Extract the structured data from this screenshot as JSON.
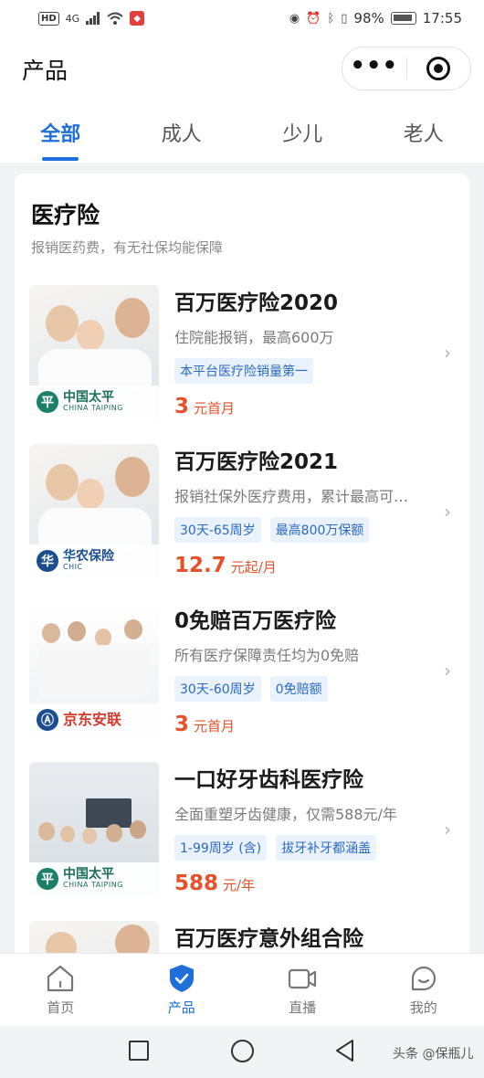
{
  "status": {
    "hd": "HD",
    "signal": "4G",
    "battery": "98%",
    "time": "17:55"
  },
  "header": {
    "title": "产品"
  },
  "tabs": [
    {
      "label": "全部"
    },
    {
      "label": "成人"
    },
    {
      "label": "少儿"
    },
    {
      "label": "老人"
    }
  ],
  "section": {
    "title": "医疗险",
    "subtitle": "报销医药费，有无社保均能保障"
  },
  "products": [
    {
      "name": "百万医疗险2020",
      "desc": "住院能报销，最高600万",
      "tags": [
        "本平台医疗险销量第一"
      ],
      "price": "3",
      "unit": "元首月",
      "logo": {
        "cn": "中国太平",
        "en": "CHINA TAIPING",
        "icon": "taiping-logo-icon"
      }
    },
    {
      "name": "百万医疗险2021",
      "desc": "报销社保外医疗费用，累计最高可…",
      "tags": [
        "30天-65周岁",
        "最高800万保额"
      ],
      "price": "12.7",
      "unit": "元起/月",
      "logo": {
        "cn": "华农保险",
        "en": "CHIC",
        "icon": "chic-logo-icon"
      }
    },
    {
      "name": "0免赔百万医疗险",
      "desc": "所有医疗保障责任均为0免赔",
      "tags": [
        "30天-60周岁",
        "0免赔额"
      ],
      "price": "3",
      "unit": "元首月",
      "logo": {
        "cn": "京东安联",
        "en": "",
        "icon": "jd-allianz-logo-icon"
      }
    },
    {
      "name": "一口好牙齿科医疗险",
      "desc": "全面重塑牙齿健康，仅需588元/年",
      "tags": [
        "1-99周岁 (含)",
        "拔牙补牙都涵盖"
      ],
      "price": "588",
      "unit": "元/年",
      "logo": {
        "cn": "中国太平",
        "en": "CHINA TAIPING",
        "icon": "taiping-logo-icon"
      }
    },
    {
      "name": "百万医疗意外组合险"
    }
  ],
  "nav": [
    {
      "label": "首页",
      "icon": "home-icon"
    },
    {
      "label": "产品",
      "icon": "shield-check-icon"
    },
    {
      "label": "直播",
      "icon": "video-camera-icon"
    },
    {
      "label": "我的",
      "icon": "smile-face-icon"
    }
  ],
  "watermark": "头条 @保瓶儿",
  "colors": {
    "accent": "#1e6fd9",
    "price": "#e8502a",
    "tag_text": "#2a6ac4",
    "tag_bg": "#eaf2fd"
  }
}
